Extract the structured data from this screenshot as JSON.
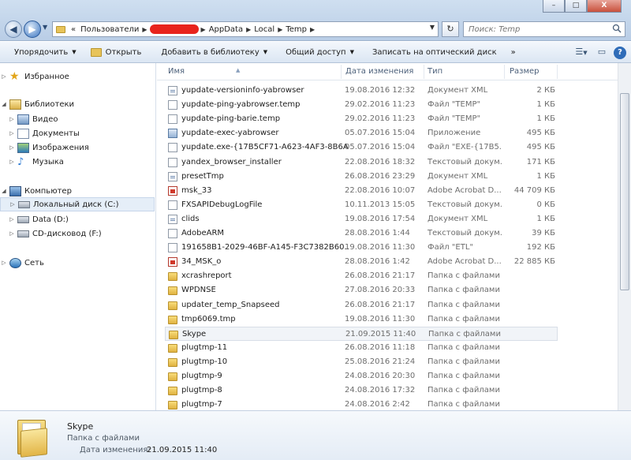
{
  "window": {
    "controls": [
      "–",
      "□",
      "X"
    ]
  },
  "address_bar": {
    "prefix": "«",
    "crumbs": [
      "Пользователи",
      "AppData",
      "Local",
      "Temp"
    ]
  },
  "search": {
    "placeholder": "Поиск: Temp"
  },
  "commands": {
    "organize": "Упорядочить",
    "open": "Открыть",
    "add_to_library": "Добавить в библиотеку",
    "share": "Общий доступ",
    "burn": "Записать на оптический диск",
    "more": "»"
  },
  "nav": {
    "favorites": "Избранное",
    "libraries": "Библиотеки",
    "video": "Видео",
    "documents": "Документы",
    "pictures": "Изображения",
    "music": "Музыка",
    "computer": "Компьютер",
    "local_disk": "Локальный диск (C:)",
    "data_disk": "Data (D:)",
    "cd_drive": "CD-дисковод (F:)",
    "network": "Сеть"
  },
  "columns": {
    "name": "Имя",
    "date": "Дата изменения",
    "type": "Тип",
    "size": "Размер"
  },
  "files": [
    {
      "name": "yupdate-versioninfo-yabrowser",
      "date": "19.08.2016 12:32",
      "type": "Документ XML",
      "size": "2 КБ",
      "icon": "xml-file-icon"
    },
    {
      "name": "yupdate-ping-yabrowser.temp",
      "date": "29.02.2016 11:23",
      "type": "Файл \"TEMP\"",
      "size": "1 КБ",
      "icon": "file-icon"
    },
    {
      "name": "yupdate-ping-barie.temp",
      "date": "29.02.2016 11:23",
      "type": "Файл \"TEMP\"",
      "size": "1 КБ",
      "icon": "file-icon"
    },
    {
      "name": "yupdate-exec-yabrowser",
      "date": "05.07.2016 15:04",
      "type": "Приложение",
      "size": "495 КБ",
      "icon": "app-icon"
    },
    {
      "name": "yupdate.exe-{17B5CF71-A623-4AF3-8B6A...",
      "date": "05.07.2016 15:04",
      "type": "Файл \"EXE-{17B5...",
      "size": "495 КБ",
      "icon": "file-icon"
    },
    {
      "name": "yandex_browser_installer",
      "date": "22.08.2016 18:32",
      "type": "Текстовый докум...",
      "size": "171 КБ",
      "icon": "file-icon"
    },
    {
      "name": "presetTmp",
      "date": "26.08.2016 23:29",
      "type": "Документ XML",
      "size": "1 КБ",
      "icon": "xml-file-icon"
    },
    {
      "name": "msk_33",
      "date": "22.08.2016 10:07",
      "type": "Adobe Acrobat D...",
      "size": "44 709 КБ",
      "icon": "pdf-icon"
    },
    {
      "name": "FXSAPIDebugLogFile",
      "date": "10.11.2013 15:05",
      "type": "Текстовый докум...",
      "size": "0 КБ",
      "icon": "file-icon"
    },
    {
      "name": "clids",
      "date": "19.08.2016 17:54",
      "type": "Документ XML",
      "size": "1 КБ",
      "icon": "xml-file-icon"
    },
    {
      "name": "AdobeARM",
      "date": "28.08.2016 1:44",
      "type": "Текстовый докум...",
      "size": "39 КБ",
      "icon": "file-icon"
    },
    {
      "name": "191658B1-2029-46BF-A145-F3C7382B60...",
      "date": "19.08.2016 11:30",
      "type": "Файл \"ETL\"",
      "size": "192 КБ",
      "icon": "file-icon"
    },
    {
      "name": "34_MSK_o",
      "date": "28.08.2016 1:42",
      "type": "Adobe Acrobat D...",
      "size": "22 885 КБ",
      "icon": "pdf-icon"
    },
    {
      "name": "xcrashreport",
      "date": "26.08.2016 21:17",
      "type": "Папка с файлами",
      "size": "",
      "icon": "folder-icon"
    },
    {
      "name": "WPDNSE",
      "date": "27.08.2016 20:33",
      "type": "Папка с файлами",
      "size": "",
      "icon": "folder-icon"
    },
    {
      "name": "updater_temp_Snapseed",
      "date": "26.08.2016 21:17",
      "type": "Папка с файлами",
      "size": "",
      "icon": "folder-icon"
    },
    {
      "name": "tmp6069.tmp",
      "date": "19.08.2016 11:30",
      "type": "Папка с файлами",
      "size": "",
      "icon": "folder-icon"
    },
    {
      "name": "Skype",
      "date": "21.09.2015 11:40",
      "type": "Папка с файлами",
      "size": "",
      "icon": "folder-icon",
      "selected": true
    },
    {
      "name": "plugtmp-11",
      "date": "26.08.2016 11:18",
      "type": "Папка с файлами",
      "size": "",
      "icon": "folder-icon"
    },
    {
      "name": "plugtmp-10",
      "date": "25.08.2016 21:24",
      "type": "Папка с файлами",
      "size": "",
      "icon": "folder-icon"
    },
    {
      "name": "plugtmp-9",
      "date": "24.08.2016 20:30",
      "type": "Папка с файлами",
      "size": "",
      "icon": "folder-icon"
    },
    {
      "name": "plugtmp-8",
      "date": "24.08.2016 17:32",
      "type": "Папка с файлами",
      "size": "",
      "icon": "folder-icon"
    },
    {
      "name": "plugtmp-7",
      "date": "24.08.2016 2:42",
      "type": "Папка с файлами",
      "size": "",
      "icon": "folder-icon"
    }
  ],
  "details": {
    "name": "Skype",
    "type": "Папка с файлами",
    "modified_label": "Дата изменения:",
    "modified_value": "21.09.2015 11:40"
  }
}
